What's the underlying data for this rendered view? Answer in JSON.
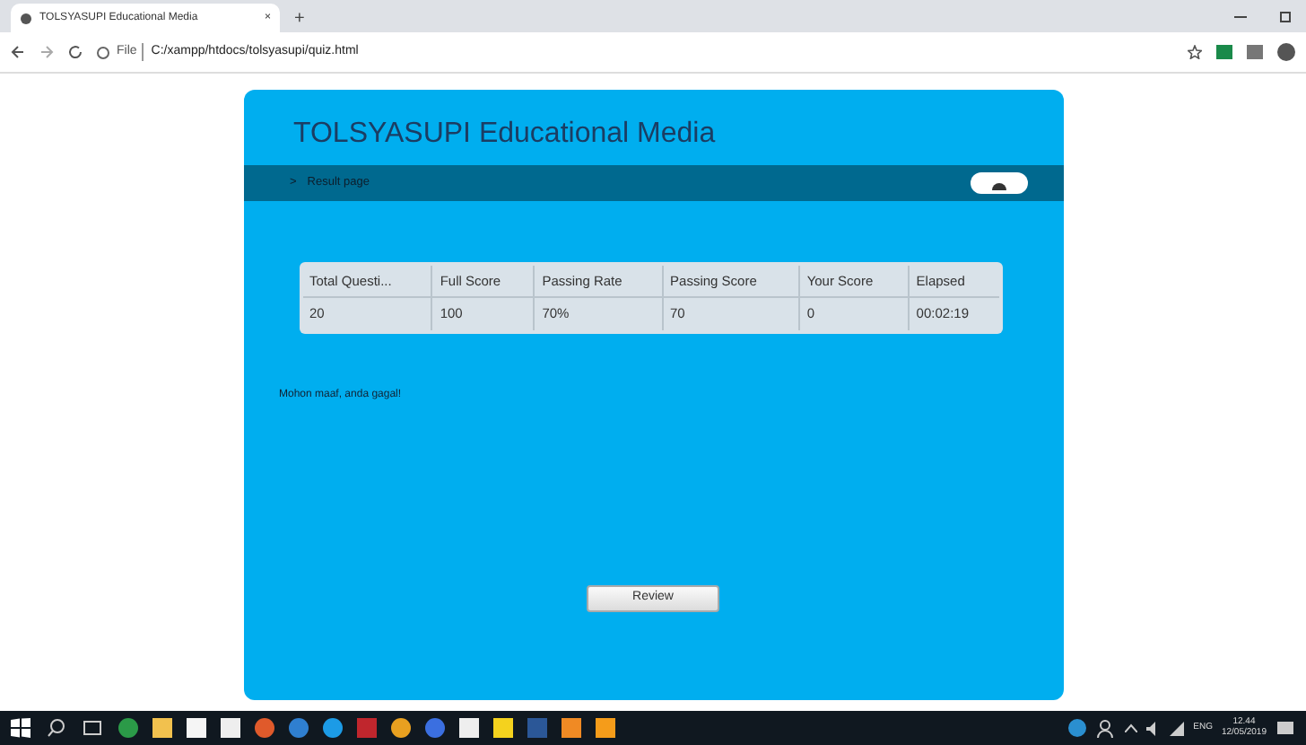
{
  "browser": {
    "tab_title": "TOLSYASUPI Educational Media",
    "tab_close": "×",
    "new_tab": "+",
    "address_scheme": "File",
    "address": "C:/xampp/htdocs/tolsyasupi/quiz.html"
  },
  "app": {
    "title": "TOLSYASUPI Educational Media",
    "breadcrumb_arrow": ">",
    "breadcrumb": "Result page"
  },
  "table": {
    "columns": [
      "Total Questi...",
      "Full Score",
      "Passing Rate",
      "Passing Score",
      "Your Score",
      "Elapsed"
    ],
    "rows": [
      [
        "20",
        "100",
        "70%",
        "70",
        "0",
        "00:02:19"
      ]
    ]
  },
  "message": "Mohon maaf, anda gagal!",
  "review_button": "Review",
  "taskbar": {
    "language": "ENG",
    "time": "12.44",
    "date": "12/05/2019"
  }
}
